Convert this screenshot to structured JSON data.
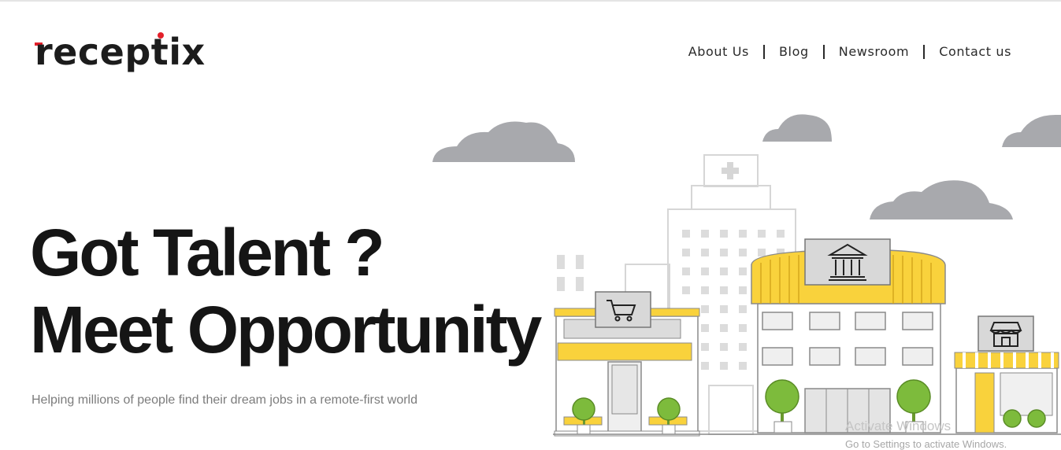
{
  "brand": {
    "name": "receptix"
  },
  "nav": {
    "items": [
      {
        "label": "About Us"
      },
      {
        "label": "Blog"
      },
      {
        "label": "Newsroom"
      },
      {
        "label": "Contact us"
      }
    ]
  },
  "hero": {
    "title_line1": "Got Talent ?",
    "title_line2": "Meet Opportunity",
    "subtitle": "Helping millions of people find their dream jobs in a remote-first world"
  },
  "illustration": {
    "icons": [
      "cart-icon",
      "bank-icon",
      "store-icon",
      "hospital-cross-icon"
    ],
    "colors": {
      "accent": "#f9d23c",
      "cloud": "#a8a9ad",
      "outline": "#d6d6d6",
      "tree": "#7dbb3c"
    }
  },
  "watermark": {
    "line1": "Activate Windows",
    "line2": "Go to Settings to activate Windows."
  }
}
